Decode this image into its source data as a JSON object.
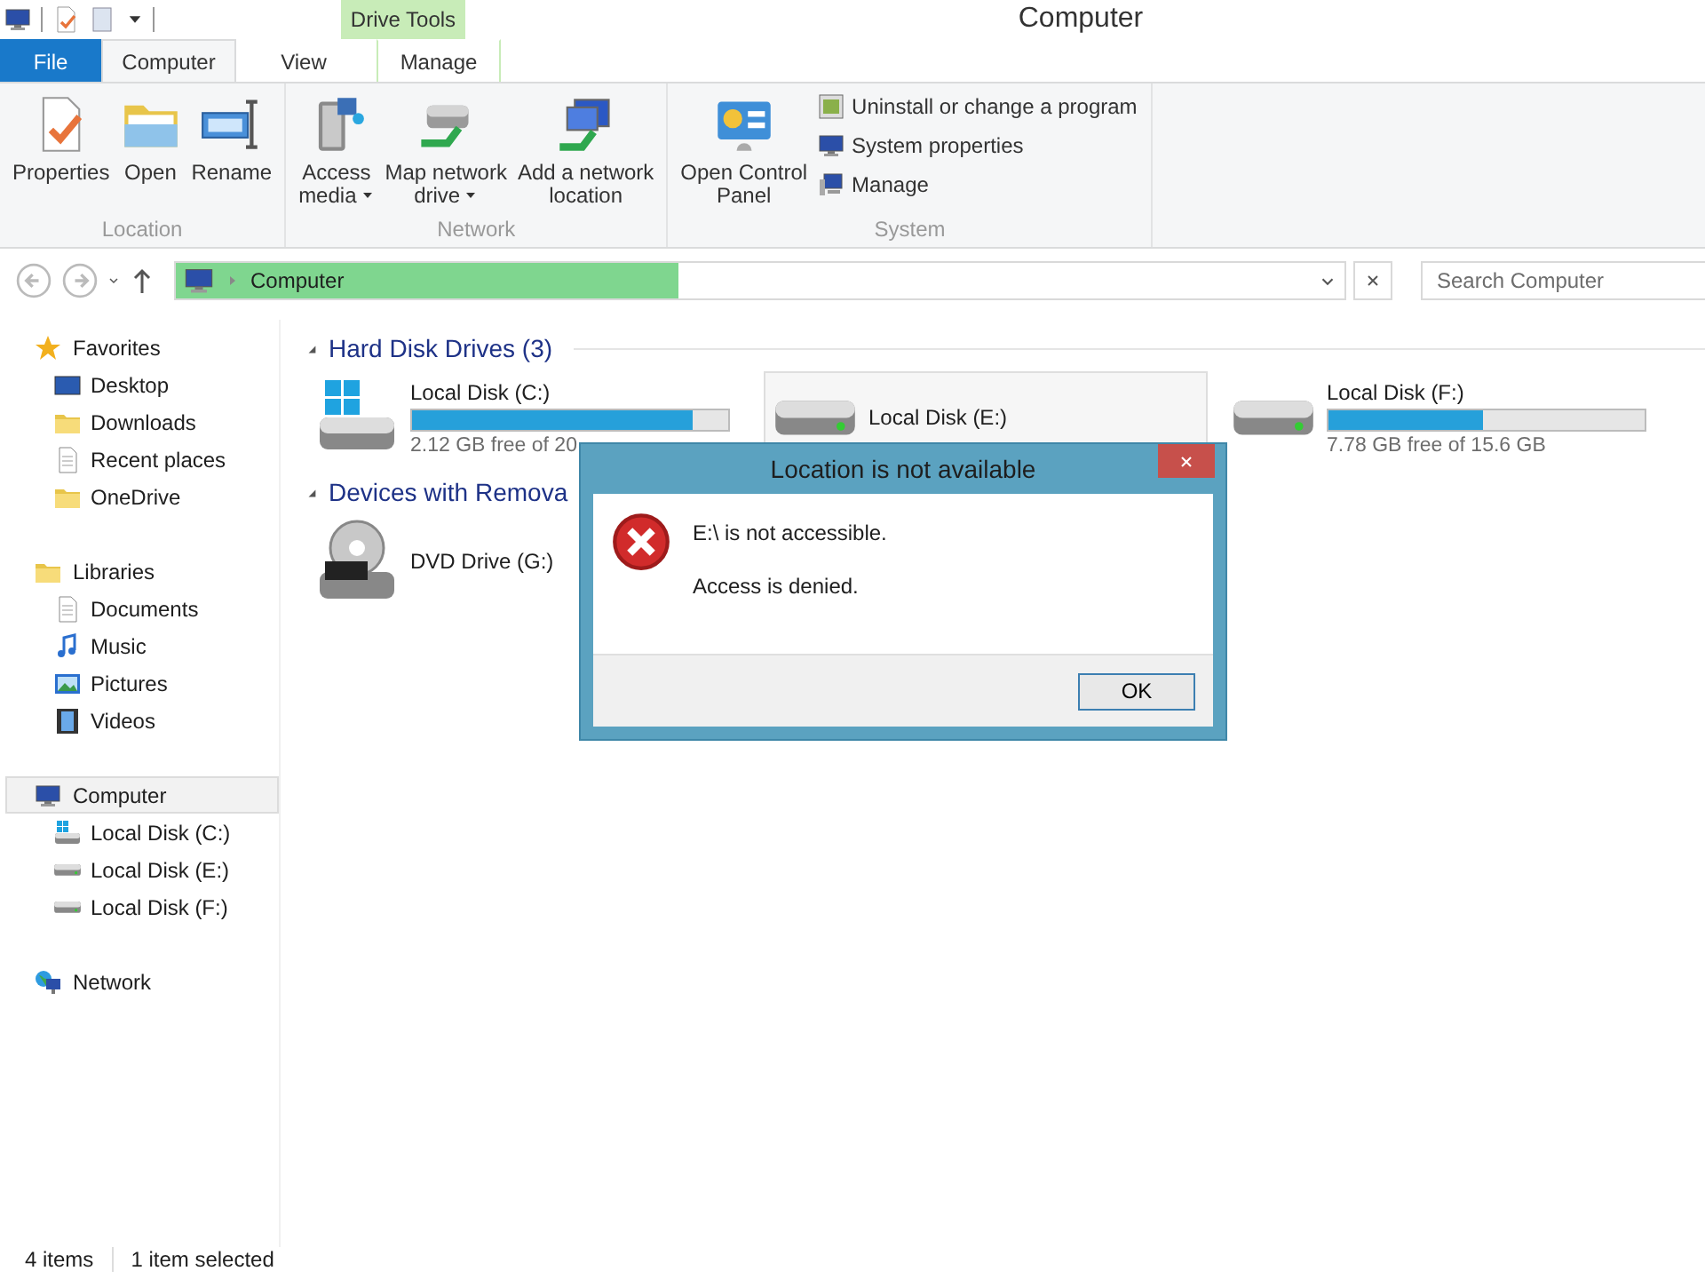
{
  "window": {
    "title": "Computer",
    "context_label": "Drive Tools"
  },
  "tabs": [
    {
      "label": "File",
      "kind": "file",
      "selected": false
    },
    {
      "label": "Computer",
      "kind": "tab",
      "selected": true
    },
    {
      "label": "View",
      "kind": "tab",
      "selected": false
    },
    {
      "label": "Manage",
      "kind": "context",
      "selected": false
    }
  ],
  "ribbon": [
    {
      "label": "Location",
      "buttons": [
        {
          "label": "Properties",
          "dropdown": false
        },
        {
          "label": "Open",
          "dropdown": false
        },
        {
          "label": "Rename",
          "dropdown": false
        }
      ]
    },
    {
      "label": "Network",
      "buttons": [
        {
          "label": "Access\nmedia",
          "dropdown": true
        },
        {
          "label": "Map network\ndrive",
          "dropdown": true
        },
        {
          "label": "Add a network\nlocation",
          "dropdown": false
        }
      ]
    },
    {
      "label": "System",
      "buttons": [
        {
          "label": "Open Control\nPanel",
          "dropdown": false
        }
      ],
      "small_buttons": [
        "Uninstall or change a program",
        "System properties",
        "Manage"
      ]
    }
  ],
  "address": {
    "crumbs": [
      "Computer"
    ],
    "level": 0.43,
    "search_placeholder": "Search Computer"
  },
  "nav": [
    {
      "label": "Favorites",
      "selected": false,
      "children": [
        {
          "label": "Desktop",
          "selected": false
        },
        {
          "label": "Downloads",
          "selected": false
        },
        {
          "label": "Recent places",
          "selected": false
        },
        {
          "label": "OneDrive",
          "selected": false
        }
      ]
    },
    {
      "label": "Libraries",
      "selected": false,
      "children": [
        {
          "label": "Documents",
          "selected": false
        },
        {
          "label": "Music",
          "selected": false
        },
        {
          "label": "Pictures",
          "selected": false
        },
        {
          "label": "Videos",
          "selected": false
        }
      ]
    },
    {
      "label": "Computer",
      "selected": true,
      "children": [
        {
          "label": "Local Disk (C:)",
          "selected": false
        },
        {
          "label": "Local Disk (E:)",
          "selected": false
        },
        {
          "label": "Local Disk (F:)",
          "selected": false
        }
      ]
    },
    {
      "label": "Network",
      "selected": false
    }
  ],
  "groups": [
    {
      "title": "Hard Disk Drives (3)",
      "expanded": true,
      "items": [
        {
          "name": "Local Disk (C:)",
          "kind": "system",
          "level": 0.89,
          "free": "2.12 GB free of 20",
          "selected": false
        },
        {
          "name": "Local Disk (E:)",
          "kind": "disk",
          "selected": true
        },
        {
          "name": "Local Disk (F:)",
          "kind": "disk",
          "level": 0.49,
          "free": "7.78 GB free of 15.6 GB",
          "selected": false
        }
      ]
    },
    {
      "title": "Devices with Remova",
      "expanded": true,
      "items": [
        {
          "name": "DVD Drive (G:)",
          "kind": "dvd",
          "selected": false
        }
      ]
    }
  ],
  "dialog": {
    "title": "Location is not available",
    "message": "E:\\ is not accessible.",
    "detail": "Access is denied.",
    "button": "OK"
  },
  "status_bar": [
    "4 items",
    "1 item selected"
  ]
}
